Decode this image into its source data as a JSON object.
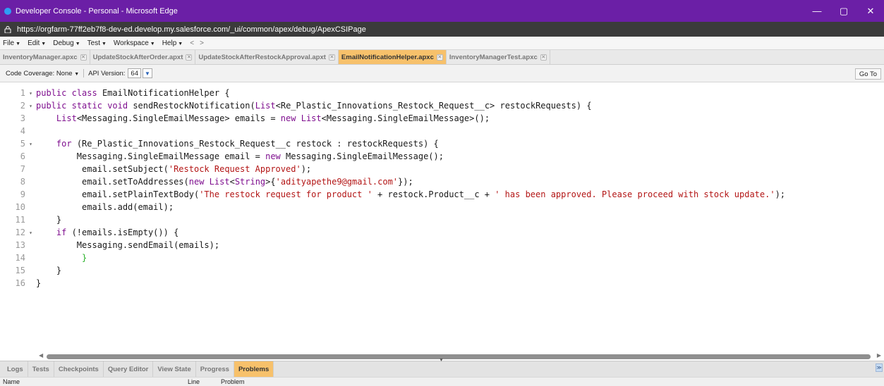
{
  "window": {
    "title": "Developer Console - Personal - Microsoft Edge",
    "controls": [
      "—",
      "▢",
      "✕"
    ]
  },
  "address": {
    "url": "https://orgfarm-77ff2eb7f8-dev-ed.develop.my.salesforce.com/_ui/common/apex/debug/ApexCSIPage"
  },
  "menubar": {
    "menus": [
      "File",
      "Edit",
      "Debug",
      "Test",
      "Workspace",
      "Help"
    ],
    "back": "<",
    "forward": ">"
  },
  "tabs": [
    {
      "label": "InventoryManager.apxc",
      "active": false
    },
    {
      "label": "UpdateStockAfterOrder.apxt",
      "active": false
    },
    {
      "label": "UpdateStockAfterRestockApproval.apxt",
      "active": false
    },
    {
      "label": "EmailNotificationHelper.apxc",
      "active": true
    },
    {
      "label": "InventoryManagerTest.apxc",
      "active": false
    }
  ],
  "toolbar": {
    "coverage_label": "Code Coverage: None",
    "api_label": "API Version:",
    "api_value": "64",
    "goto_label": "Go To"
  },
  "code": {
    "lines": [
      {
        "n": "1",
        "fold": "▾",
        "text": "public class EmailNotificationHelper {"
      },
      {
        "n": "2",
        "fold": "▾",
        "text": "public static void sendRestockNotification(List<Re_Plastic_Innovations_Restock_Request__c> restockRequests) {"
      },
      {
        "n": "3",
        "fold": "",
        "text": "    List<Messaging.SingleEmailMessage> emails = new List<Messaging.SingleEmailMessage>();"
      },
      {
        "n": "4",
        "fold": "",
        "text": ""
      },
      {
        "n": "5",
        "fold": "▾",
        "text": "    for (Re_Plastic_Innovations_Restock_Request__c restock : restockRequests) {"
      },
      {
        "n": "6",
        "fold": "",
        "text": "        Messaging.SingleEmailMessage email = new Messaging.SingleEmailMessage();"
      },
      {
        "n": "7",
        "fold": "",
        "text": "         email.setSubject('Restock Request Approved');"
      },
      {
        "n": "8",
        "fold": "",
        "text": "         email.setToAddresses(new List<String>{'adityapethe9@gmail.com'});"
      },
      {
        "n": "9",
        "fold": "",
        "text": "         email.setPlainTextBody('The restock request for product ' + restock.Product__c + ' has been approved. Please proceed with stock update.');"
      },
      {
        "n": "10",
        "fold": "",
        "text": "         emails.add(email);"
      },
      {
        "n": "11",
        "fold": "",
        "text": "    }"
      },
      {
        "n": "12",
        "fold": "▾",
        "text": "    if (!emails.isEmpty()) {"
      },
      {
        "n": "13",
        "fold": "",
        "text": "        Messaging.sendEmail(emails);"
      },
      {
        "n": "14",
        "fold": "",
        "text": "         }"
      },
      {
        "n": "15",
        "fold": "",
        "text": "    }"
      },
      {
        "n": "16",
        "fold": "",
        "text": "}"
      }
    ]
  },
  "panel": {
    "tabs": [
      {
        "label": "Logs",
        "active": false
      },
      {
        "label": "Tests",
        "active": false
      },
      {
        "label": "Checkpoints",
        "active": false
      },
      {
        "label": "Query Editor",
        "active": false
      },
      {
        "label": "View State",
        "active": false
      },
      {
        "label": "Progress",
        "active": false
      },
      {
        "label": "Problems",
        "active": true
      }
    ],
    "columns": [
      "Name",
      "Line",
      "Problem"
    ]
  }
}
